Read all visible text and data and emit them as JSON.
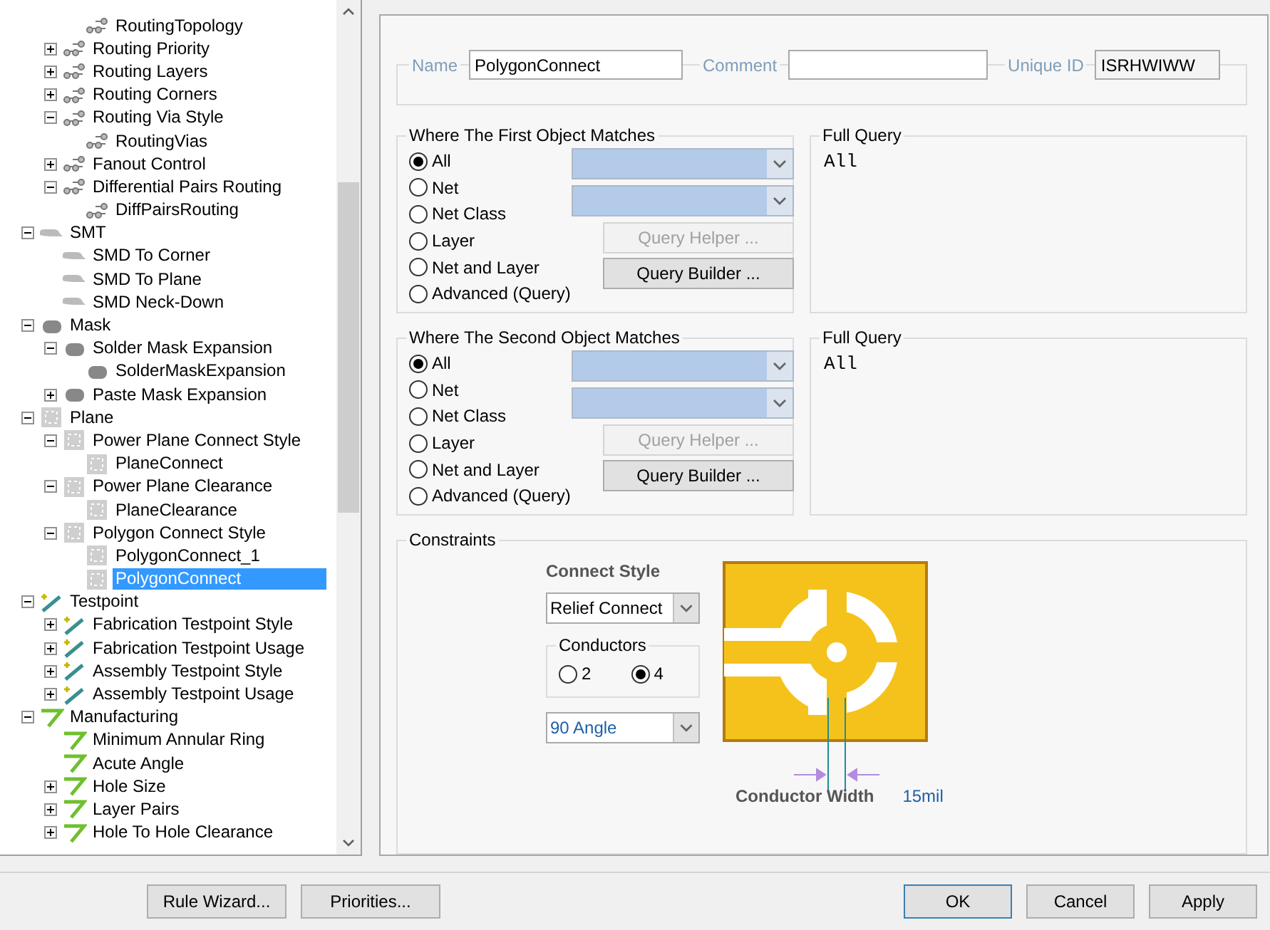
{
  "tree": {
    "top_partial": [
      {
        "label": "RoutingTopology",
        "kind": "routing",
        "selected": false
      }
    ],
    "routing_rules": [
      {
        "label": "Routing Priority",
        "kind": "routing",
        "expanded": false,
        "selected": false
      },
      {
        "label": "Routing Layers",
        "kind": "routing",
        "expanded": false,
        "selected": false
      },
      {
        "label": "Routing Corners",
        "kind": "routing",
        "expanded": false,
        "selected": false
      },
      {
        "label": "Routing Via Style",
        "kind": "routing",
        "expanded": true,
        "selected": false,
        "children": [
          {
            "label": "RoutingVias",
            "kind": "routing",
            "selected": false
          }
        ]
      },
      {
        "label": "Fanout Control",
        "kind": "routing",
        "expanded": false,
        "selected": false
      },
      {
        "label": "Differential Pairs Routing",
        "kind": "routing",
        "expanded": true,
        "selected": false,
        "children": [
          {
            "label": "DiffPairsRouting",
            "kind": "routing",
            "selected": false
          }
        ]
      }
    ],
    "categories": [
      {
        "label": "SMT",
        "kind": "smt",
        "expanded": true,
        "selected": false,
        "children": [
          {
            "label": "SMD To Corner",
            "kind": "smt",
            "selected": false
          },
          {
            "label": "SMD To Plane",
            "kind": "smt",
            "selected": false
          },
          {
            "label": "SMD Neck-Down",
            "kind": "smt",
            "selected": false
          }
        ]
      },
      {
        "label": "Mask",
        "kind": "mask",
        "expanded": true,
        "selected": false,
        "children": [
          {
            "label": "Solder Mask Expansion",
            "kind": "mask",
            "expanded": true,
            "selected": false,
            "children": [
              {
                "label": "SolderMaskExpansion",
                "kind": "mask",
                "selected": false
              }
            ]
          },
          {
            "label": "Paste Mask Expansion",
            "kind": "mask",
            "expanded": false,
            "selected": false
          }
        ]
      },
      {
        "label": "Plane",
        "kind": "plane",
        "expanded": true,
        "selected": false,
        "children": [
          {
            "label": "Power Plane Connect Style",
            "kind": "plane",
            "expanded": true,
            "selected": false,
            "children": [
              {
                "label": "PlaneConnect",
                "kind": "plane",
                "selected": false
              }
            ]
          },
          {
            "label": "Power Plane Clearance",
            "kind": "plane",
            "expanded": true,
            "selected": false,
            "children": [
              {
                "label": "PlaneClearance",
                "kind": "plane",
                "selected": false
              }
            ]
          },
          {
            "label": "Polygon Connect Style",
            "kind": "plane",
            "expanded": true,
            "selected": false,
            "children": [
              {
                "label": "PolygonConnect_1",
                "kind": "plane",
                "selected": false
              },
              {
                "label": "PolygonConnect",
                "kind": "plane",
                "selected": true
              }
            ]
          }
        ]
      },
      {
        "label": "Testpoint",
        "kind": "testpoint",
        "expanded": true,
        "selected": false,
        "children": [
          {
            "label": "Fabrication Testpoint Style",
            "kind": "testpoint",
            "expanded": false,
            "selected": false
          },
          {
            "label": "Fabrication Testpoint Usage",
            "kind": "testpoint",
            "expanded": false,
            "selected": false
          },
          {
            "label": "Assembly Testpoint Style",
            "kind": "testpoint",
            "expanded": false,
            "selected": false
          },
          {
            "label": "Assembly Testpoint Usage",
            "kind": "testpoint",
            "expanded": false,
            "selected": false
          }
        ]
      },
      {
        "label": "Manufacturing",
        "kind": "manufacturing",
        "expanded": true,
        "selected": false,
        "children": [
          {
            "label": "Minimum Annular Ring",
            "kind": "manufacturing",
            "selected": false
          },
          {
            "label": "Acute Angle",
            "kind": "manufacturing",
            "selected": false
          },
          {
            "label": "Hole Size",
            "kind": "manufacturing",
            "expanded": false,
            "selected": false
          },
          {
            "label": "Layer Pairs",
            "kind": "manufacturing",
            "expanded": false,
            "selected": false
          },
          {
            "label": "Hole To Hole Clearance",
            "kind": "manufacturing",
            "expanded": false,
            "selected": false
          }
        ]
      }
    ]
  },
  "rule_fields": [
    {
      "label": "Name",
      "value": "PolygonConnect"
    },
    {
      "label": "Comment"
    },
    {
      "label": "Unique ID",
      "value": "ISRHWIWW"
    }
  ],
  "object_matches": [
    {
      "title": "Where The First Object Matches",
      "options": [
        {
          "label": "All",
          "selected": true
        },
        {
          "label": "Net",
          "selected": false
        },
        {
          "label": "Net Class",
          "selected": false
        },
        {
          "label": "Layer",
          "selected": false
        },
        {
          "label": "Net and Layer",
          "selected": false
        },
        {
          "label": "Advanced (Query)",
          "selected": false
        }
      ],
      "buttons": [
        {
          "label": "Query Helper ...",
          "disabled": true
        },
        {
          "label": "Query Builder ...",
          "disabled": false
        }
      ],
      "full_query": {
        "title": "Full Query",
        "text": "All"
      }
    },
    {
      "title": "Where The Second Object Matches",
      "options": [
        {
          "label": "All",
          "selected": true
        },
        {
          "label": "Net",
          "selected": false
        },
        {
          "label": "Net Class",
          "selected": false
        },
        {
          "label": "Layer",
          "selected": false
        },
        {
          "label": "Net and Layer",
          "selected": false
        },
        {
          "label": "Advanced (Query)",
          "selected": false
        }
      ],
      "buttons": [
        {
          "label": "Query Helper ...",
          "disabled": true
        },
        {
          "label": "Query Builder ...",
          "disabled": false
        }
      ],
      "full_query": {
        "title": "Full Query",
        "text": "All"
      }
    }
  ],
  "constraints": {
    "title": "Constraints",
    "connect_style_label": "Connect Style",
    "connect_style": "Relief Connect",
    "conductors": {
      "title": "Conductors",
      "options": [
        {
          "label": "2",
          "selected": false
        },
        {
          "label": "4",
          "selected": true
        }
      ]
    },
    "angle": "90 Angle",
    "width_label": "Conductor Width",
    "width_value": "15mil"
  },
  "footer": {
    "left": [
      {
        "label": "Rule Wizard...",
        "default": false
      },
      {
        "label": "Priorities...",
        "default": false
      }
    ],
    "right": [
      {
        "label": "OK",
        "default": true
      },
      {
        "label": "Cancel",
        "default": false
      },
      {
        "label": "Apply",
        "default": false
      }
    ]
  }
}
